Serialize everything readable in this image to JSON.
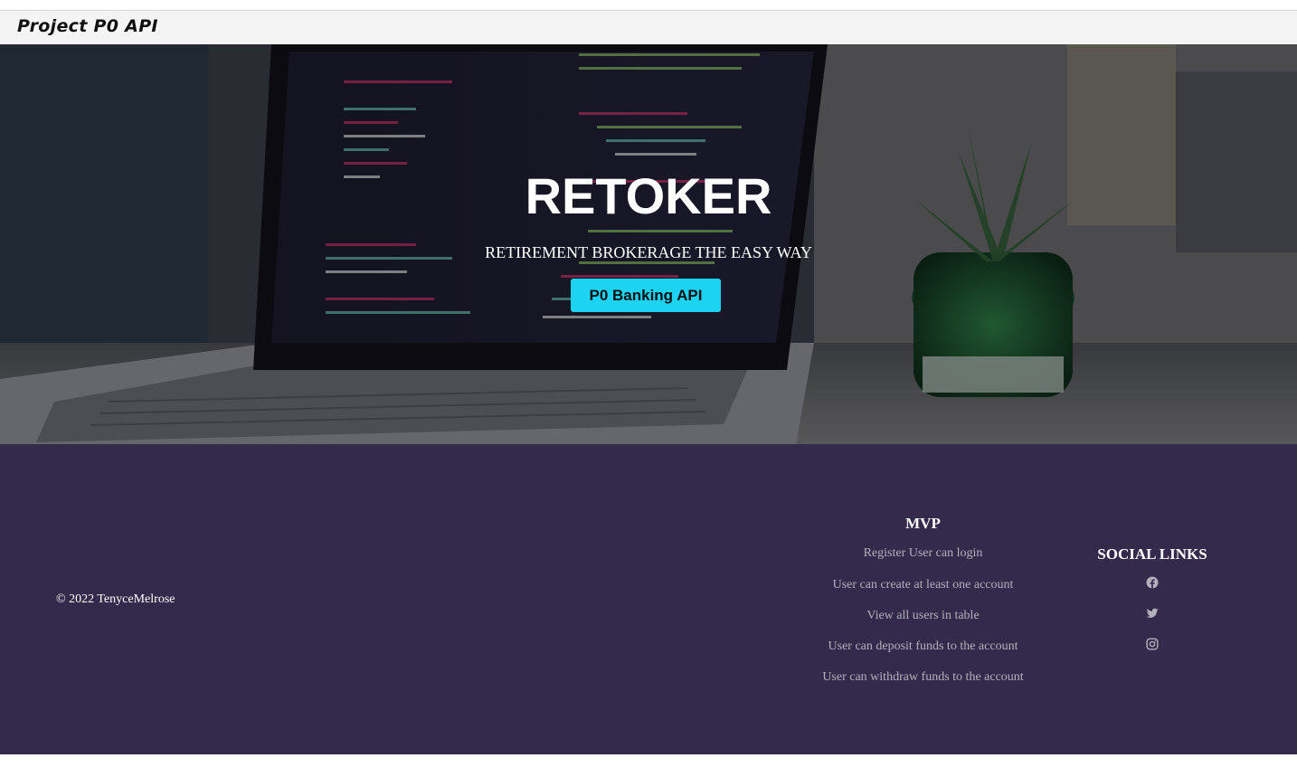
{
  "navbar": {
    "brand": "Project P0 API"
  },
  "hero": {
    "title": "RETOKER",
    "subtitle": "RETIREMENT BROKERAGE THE EASY WAY",
    "button_label": "P0 Banking API",
    "accent_color": "#1cd3f2"
  },
  "footer": {
    "background_color": "#342a4b",
    "copyright": "© 2022 TenyceMelrose",
    "mvp": {
      "heading": "MVP",
      "items": [
        "Register User can login",
        "User can create at least one account",
        "View all users in table",
        "User can deposit funds to the account",
        "User can withdraw funds to the account"
      ]
    },
    "social": {
      "heading": "SOCIAL LINKS",
      "links": [
        {
          "icon": "facebook-icon"
        },
        {
          "icon": "twitter-icon"
        },
        {
          "icon": "instagram-icon"
        }
      ]
    }
  }
}
